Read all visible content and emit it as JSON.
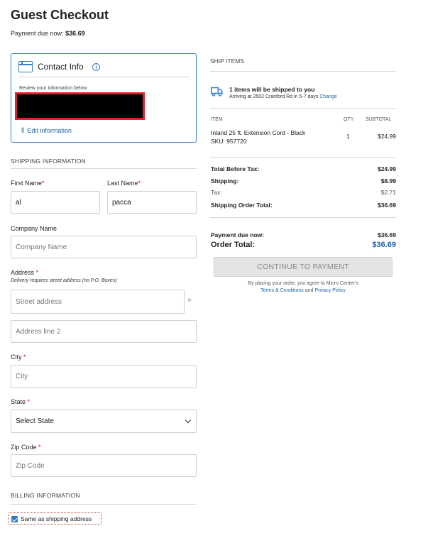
{
  "page": {
    "title": "Guest Checkout",
    "due_label": "Payment due now:",
    "due_value": "$36.69"
  },
  "contact": {
    "title": "Contact Info",
    "info_glyph": "i",
    "review_text": "Review your information below",
    "edit_label": "Edit information",
    "edit_glyph": "✎"
  },
  "shipping": {
    "section_title": "SHIPPING INFORMATION",
    "required_mark": "*",
    "first_name": {
      "label": "First Name",
      "value": "al"
    },
    "last_name": {
      "label": "Last Name",
      "value": "pacca"
    },
    "company": {
      "label": "Company Name",
      "placeholder": "Company Name"
    },
    "address": {
      "label": "Address",
      "note": "Delivery requires street address (no P.O. Boxes)",
      "street_placeholder": "Street address",
      "clear_glyph": "×",
      "line2_placeholder": "Address line 2"
    },
    "city": {
      "label": "City",
      "placeholder": "City"
    },
    "state": {
      "label": "State",
      "selected": "Select State"
    },
    "zip": {
      "label": "Zip Code",
      "placeholder": "Zip Code"
    }
  },
  "billing": {
    "section_title": "BILLING INFORMATION",
    "same_as_shipping_label": "Same as shipping address",
    "same_as_shipping_checked": true
  },
  "ship_items": {
    "section_title": "SHIP ITEMS",
    "summary": "1 items will be shipped to you",
    "arriving_text": "Arriving at 2502 Cranford Rd in 5-7 days",
    "change_label": "Change",
    "columns": {
      "item": "ITEM",
      "qty": "QTY",
      "subtotal": "SUBTOTAL"
    },
    "items": [
      {
        "name": "Inland 25 ft. Extension Cord - Black",
        "sku": "SKU: 957720",
        "qty": "1",
        "subtotal": "$24.99"
      }
    ]
  },
  "totals": {
    "before_tax": {
      "label": "Total Before Tax:",
      "value": "$24.99"
    },
    "shipping": {
      "label": "Shipping:",
      "value": "$8.99"
    },
    "tax": {
      "label": "Tax:",
      "value": "$2.71"
    },
    "shipping_order_total": {
      "label": "Shipping Order Total:",
      "value": "$36.69"
    },
    "payment_due": {
      "label": "Payment due now:",
      "value": "$36.69"
    },
    "order_total": {
      "label": "Order Total:",
      "value": "$36.69"
    }
  },
  "actions": {
    "continue_label": "CONTINUE TO PAYMENT",
    "agree_prefix": "By placing your order, you agree to Micro Center's",
    "terms_label": "Terms & Conditions",
    "and_text": "and",
    "privacy_label": "Privacy Policy"
  },
  "colors": {
    "accent": "#2463a8",
    "card_border": "#3a7fc4",
    "required": "#d0021b",
    "redaction_border": "#e0242e",
    "disabled_button": "#e4e4e4"
  },
  "icons": {
    "contact": "contact-card-icon",
    "info": "info-icon",
    "edit": "pencil-icon",
    "truck": "truck-icon",
    "clear": "close-icon",
    "select": "chevron-down-icon",
    "checkbox": "checkmark-icon"
  }
}
